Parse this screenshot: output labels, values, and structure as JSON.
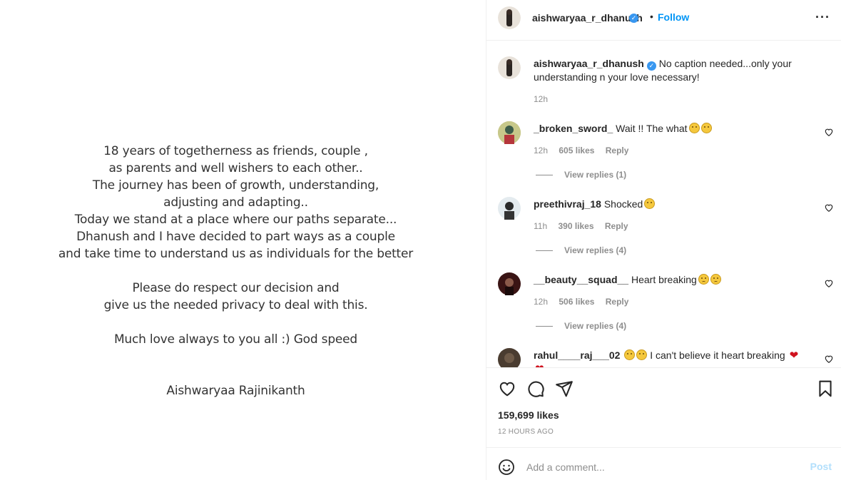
{
  "post_image": {
    "lines_block1": [
      "18 years of togetherness as friends, couple ,",
      "as parents and well wishers to each other..",
      "The journey has been of growth, understanding,",
      "adjusting and adapting..",
      "Today we stand at a place where our paths separate...",
      "Dhanush and I have decided to part ways as a couple",
      "and take time to understand us as individuals for the better"
    ],
    "lines_block2": [
      "Please do respect our decision and",
      "give us the needed privacy to deal with this."
    ],
    "line_block3": "Much love always to you all :) God speed",
    "signature": "Aishwaryaa Rajinikanth"
  },
  "header": {
    "username": "aishwaryaa_r_dhanush",
    "separator": "•",
    "follow_label": "Follow",
    "more_label": "···"
  },
  "caption": {
    "username": "aishwaryaa_r_dhanush",
    "text": "No caption needed...only your understanding n your love necessary!",
    "time": "12h"
  },
  "comments": [
    {
      "username": "_broken_sword_",
      "text": "Wait !! The what",
      "time": "12h",
      "likes": "605 likes",
      "reply": "Reply",
      "view_replies": "View replies (1)",
      "avatar_color": "#c9c07a"
    },
    {
      "username": "preethivraj_18",
      "text": "Shocked",
      "time": "11h",
      "likes": "390 likes",
      "reply": "Reply",
      "view_replies": "View replies (4)",
      "avatar_color": "#dfe7ec"
    },
    {
      "username": "__beauty__squad__",
      "text": "Heart breaking",
      "time": "12h",
      "likes": "506 likes",
      "reply": "Reply",
      "view_replies": "View replies (4)",
      "avatar_color": "#3a1414"
    },
    {
      "username": "rahul____raj___02",
      "text": "I can't believe it heart breaking",
      "avatar_color": "#4a3c30"
    }
  ],
  "actions": {
    "likes": "159,699 likes",
    "time_ago": "12 HOURS AGO"
  },
  "add_comment": {
    "placeholder": "Add a comment...",
    "post_label": "Post"
  },
  "colors": {
    "accent": "#0095f6",
    "muted": "#8e8e8e",
    "border": "#efefef"
  }
}
